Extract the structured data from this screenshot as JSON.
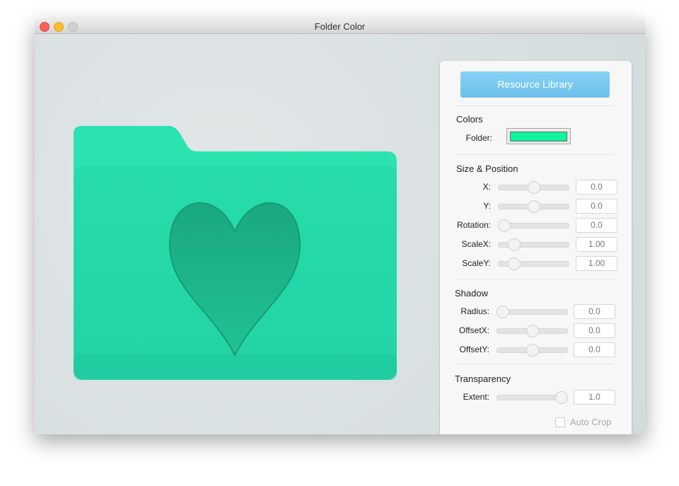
{
  "window": {
    "title": "Folder Color"
  },
  "panel": {
    "resource_button": "Resource Library",
    "colors": {
      "heading": "Colors",
      "folder_label": "Folder:",
      "folder_color": "#0ef59b"
    },
    "size_position": {
      "heading": "Size & Position",
      "rows": [
        {
          "label": "X:",
          "value": "0.0",
          "fraction": 0.5
        },
        {
          "label": "Y:",
          "value": "0.0",
          "fraction": 0.5
        },
        {
          "label": "Rotation:",
          "value": "0.0",
          "fraction": 0.0
        },
        {
          "label": "ScaleX:",
          "value": "1.00",
          "fraction": 0.17
        },
        {
          "label": "ScaleY:",
          "value": "1.00",
          "fraction": 0.17
        }
      ]
    },
    "shadow": {
      "heading": "Shadow",
      "rows": [
        {
          "label": "Radius:",
          "value": "0.0",
          "fraction": 0.0
        },
        {
          "label": "OffsetX:",
          "value": "0.0",
          "fraction": 0.5
        },
        {
          "label": "OffsetY:",
          "value": "0.0",
          "fraction": 0.5
        }
      ]
    },
    "transparency": {
      "heading": "Transparency",
      "rows": [
        {
          "label": "Extent:",
          "value": "1.0",
          "fraction": 1.0
        }
      ]
    },
    "auto_crop": {
      "label": "Auto Crop",
      "checked": false
    }
  },
  "preview": {
    "folder_color": "#25dcae",
    "icon": "heart-icon"
  }
}
